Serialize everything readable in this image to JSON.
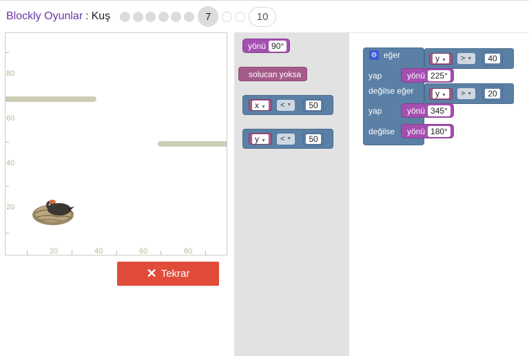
{
  "header": {
    "app_title": "Blockly Oyunlar",
    "separator": ":",
    "game_title": "Kuş",
    "current_level": "7",
    "last_level": "10"
  },
  "game": {
    "y_labels": [
      "80",
      "60",
      "40",
      "20"
    ],
    "x_labels": [
      "20",
      "40",
      "60",
      "80"
    ]
  },
  "reset_button": {
    "label": "Tekrar"
  },
  "toolbox": {
    "heading_block": {
      "label": "yönü",
      "value": "90°"
    },
    "no_worm_block": {
      "label": "solucan yoksa"
    },
    "compare_x": {
      "var": "x",
      "op": "<",
      "value": "50"
    },
    "compare_y": {
      "var": "y",
      "op": "<",
      "value": "50"
    }
  },
  "workspace": {
    "if_label": "eğer",
    "do_label_1": "yap",
    "elseif_label": "değilse eğer",
    "do_label_2": "yap",
    "else_label": "değilse",
    "cond1": {
      "var": "y",
      "op": ">",
      "value": "40"
    },
    "heading1": {
      "label": "yönü",
      "value": "225°"
    },
    "cond2": {
      "var": "y",
      "op": ">",
      "value": "20"
    },
    "heading2": {
      "label": "yönü",
      "value": "345°"
    },
    "heading3": {
      "label": "yönü",
      "value": "180°"
    }
  },
  "colors": {
    "accent_purple": "#6a35a8",
    "reset_red": "#e04b3a",
    "logic_blue": "#5b80a5",
    "variable_pink": "#a55b8a",
    "heading_violet": "#a44fb0",
    "toolbox_gray": "#e2e2e2"
  }
}
